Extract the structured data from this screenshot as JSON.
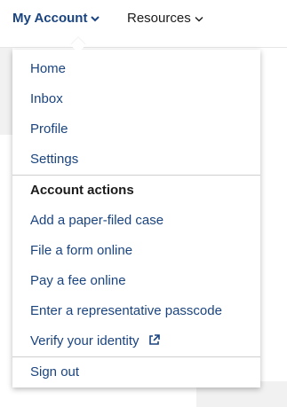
{
  "nav": {
    "my_account_label": "My Account",
    "resources_label": "Resources"
  },
  "menu": {
    "items": [
      {
        "label": "Home"
      },
      {
        "label": "Inbox"
      },
      {
        "label": "Profile"
      },
      {
        "label": "Settings"
      }
    ],
    "section_heading": "Account actions",
    "actions": [
      {
        "label": "Add a paper-filed case"
      },
      {
        "label": "File a form online"
      },
      {
        "label": "Pay a fee online"
      },
      {
        "label": "Enter a representative passcode"
      },
      {
        "label": "Verify your identity",
        "icon": "external-link-icon"
      }
    ],
    "sign_out_label": "Sign out"
  },
  "colors": {
    "link": "#1a4480",
    "text": "#1b1b1b",
    "background_gray": "#f1f1f1"
  }
}
